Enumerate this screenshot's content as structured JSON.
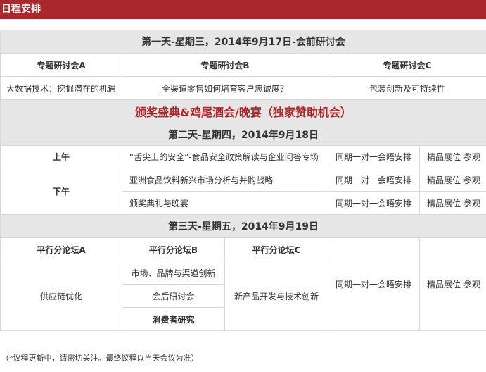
{
  "title": "日程安排",
  "day1": {
    "heading": "第一天-星期三，2014年9月17日-会前研讨会",
    "sessions": [
      {
        "label": "专题研讨会A",
        "topic": "大数据技术：挖掘潜在的机遇"
      },
      {
        "label": "专题研讨会B",
        "topic": "全渠道零售如何培育客户忠诚度？"
      },
      {
        "label": "专题研讨会C",
        "topic": "包装创新及可持续性"
      }
    ]
  },
  "gala": "颁奖盛典&鸡尾酒会/晚宴（独家赞助机会）",
  "day2": {
    "heading": "第二天-星期四，2014年9月18日",
    "morning": "上午",
    "afternoon": "下午",
    "items": [
      "“舌尖上的安全”-食品安全政策解读与企业问答专场",
      "亚洲食品饮料新兴市场分析与并购战略",
      "颁奖典礼与晚宴"
    ],
    "meeting": "同期一对一会晤安排",
    "exhibit": "精品展位 参观"
  },
  "day3": {
    "heading": "第三天-星期五，2014年9月19日",
    "forum_a": "平行分论坛A",
    "forum_b": "平行分论坛B",
    "forum_c": "平行分论坛C",
    "a_topic": "供应链优化",
    "b_topics": [
      "市场、品牌与渠道创新",
      "会后研讨会",
      "消费者研究"
    ],
    "c_topic": "新产品开发与技术创新",
    "meeting": "同期一对一会晤安排",
    "exhibit": "精品展位 参观"
  },
  "note": "（*议程更新中，请密切关注。最终议程以当天会议为准）"
}
